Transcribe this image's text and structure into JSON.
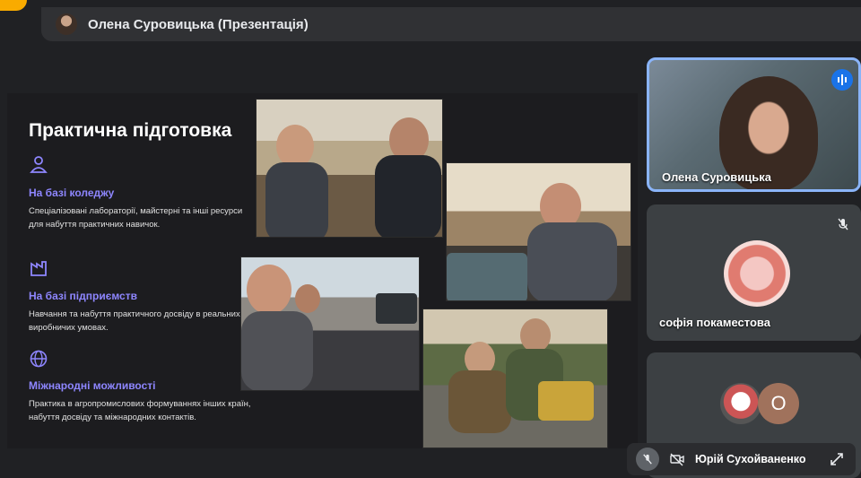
{
  "presenter_bar": {
    "label": "Олена Суровицька (Презентація)",
    "avatar_icon": "user-photo"
  },
  "slide": {
    "title": "Практична підготовка",
    "sections": [
      {
        "icon": "person-icon",
        "heading": "На базі коледжу",
        "text": "Спеціалізовані лабораторії, майстерні та інші ресурси для набуття практичних навичок."
      },
      {
        "icon": "factory-icon",
        "heading": "На базі підприємств",
        "text": "Навчання та набуття практичного досвіду в реальних виробничих умовах."
      },
      {
        "icon": "globe-icon",
        "heading": "Міжнародні можливості",
        "text": "Практика в агропромислових формуваннях інших країн, набуття досвіду та міжнародних контактів."
      }
    ]
  },
  "participants": [
    {
      "name": "Олена Суровицька",
      "status": "speaking"
    },
    {
      "name": "софія покаместова",
      "status": "muted"
    },
    {
      "avatar_letter": "О"
    }
  ],
  "bottom_bar": {
    "name": "Юрій Сухойваненко"
  },
  "colors": {
    "accent": "#8e86ff",
    "active_border": "#8ab4f8",
    "speaking_badge": "#1a73e8"
  }
}
